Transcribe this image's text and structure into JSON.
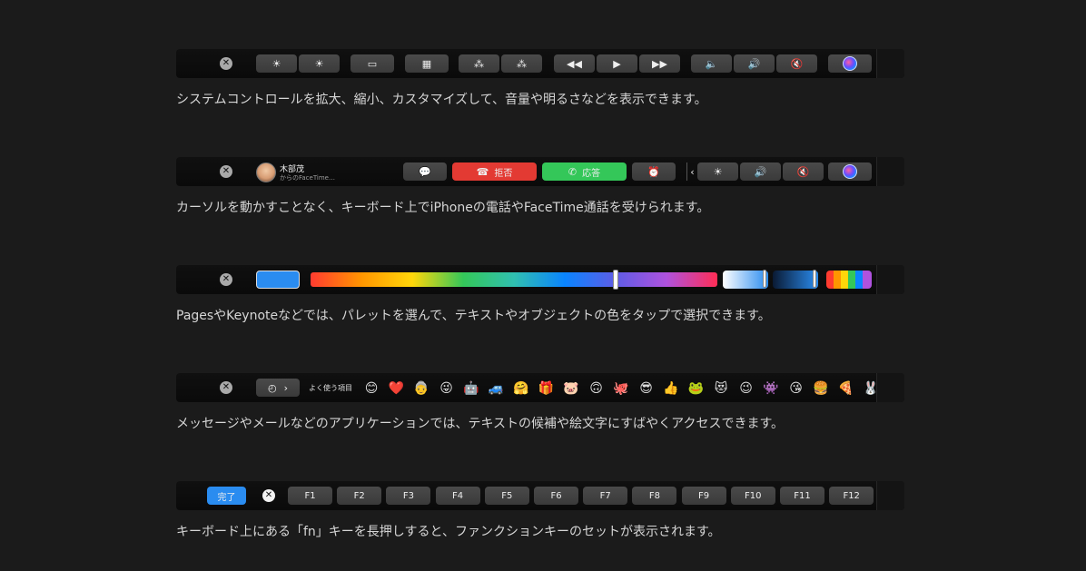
{
  "sections": [
    {
      "caption": "システムコントロールを拡大、縮小、カスタマイズして、音量や明るさなどを表示できます。",
      "keys": [
        {
          "name": "brightness-down-key",
          "icon": "☀"
        },
        {
          "name": "brightness-up-key",
          "icon": "☀"
        },
        {
          "name": "mission-control-key",
          "icon": "▭"
        },
        {
          "name": "launchpad-key",
          "icon": "▦"
        },
        {
          "name": "keyboard-brightness-down-key",
          "icon": "⁂"
        },
        {
          "name": "keyboard-brightness-up-key",
          "icon": "⁂"
        },
        {
          "name": "rewind-key",
          "icon": "◀◀"
        },
        {
          "name": "play-key",
          "icon": "▶"
        },
        {
          "name": "fast-forward-key",
          "icon": "▶▶"
        },
        {
          "name": "volume-down-key",
          "icon": "🔈"
        },
        {
          "name": "volume-up-key",
          "icon": "🔊"
        },
        {
          "name": "mute-key",
          "icon": "🔇"
        }
      ]
    },
    {
      "caption": "カーソルを動かすことなく、キーボード上でiPhoneの電話やFaceTime通話を受けられます。",
      "caller_name": "木部茂",
      "caller_sub": "からのFaceTime…",
      "decline_label": "拒否",
      "accept_label": "応答"
    },
    {
      "caption": "PagesやKeynoteなどでは、パレットを選んで、テキストやオブジェクトの色をタップで選択できます。",
      "selected_color": "#2a8cf0",
      "hue_position": 0.75
    },
    {
      "caption": "メッセージやメールなどのアプリケーションでは、テキストの候補や絵文字にすばやくアクセスできます。",
      "frequently_used_label": "よく使う項目",
      "emojis": [
        "😊",
        "❤️",
        "👵",
        "😜",
        "🤖",
        "🚙",
        "🤗",
        "🎁",
        "🐷",
        "🙃",
        "🐙",
        "😎",
        "👍",
        "🐸",
        "😻",
        "😉",
        "👾",
        "😘",
        "🍔",
        "🍕",
        "🐰"
      ]
    },
    {
      "caption": "キーボード上にある「fn」キーを長押しすると、ファンクションキーのセットが表示されます。",
      "done_label": "完了",
      "fkeys": [
        "F1",
        "F2",
        "F3",
        "F4",
        "F5",
        "F6",
        "F7",
        "F8",
        "F9",
        "F10",
        "F11",
        "F12"
      ]
    }
  ]
}
